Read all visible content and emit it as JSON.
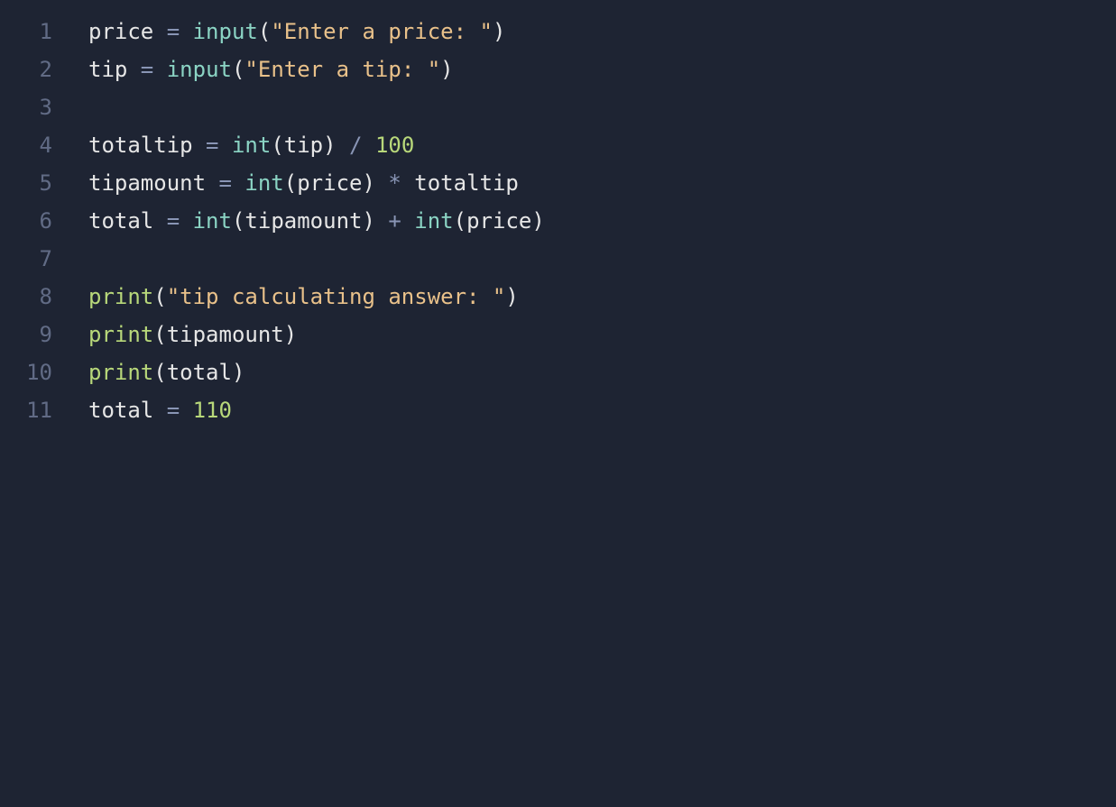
{
  "code": {
    "lines": [
      {
        "num": "1",
        "tokens": [
          {
            "cls": "tok-var",
            "text": "price"
          },
          {
            "cls": "tok-op",
            "text": " = "
          },
          {
            "cls": "tok-func",
            "text": "input"
          },
          {
            "cls": "tok-punct",
            "text": "("
          },
          {
            "cls": "tok-str",
            "text": "\"Enter a price: \""
          },
          {
            "cls": "tok-punct",
            "text": ")"
          }
        ]
      },
      {
        "num": "2",
        "tokens": [
          {
            "cls": "tok-var",
            "text": "tip"
          },
          {
            "cls": "tok-op",
            "text": " = "
          },
          {
            "cls": "tok-func",
            "text": "input"
          },
          {
            "cls": "tok-punct",
            "text": "("
          },
          {
            "cls": "tok-str",
            "text": "\"Enter a tip: \""
          },
          {
            "cls": "tok-punct",
            "text": ")"
          }
        ]
      },
      {
        "num": "3",
        "tokens": []
      },
      {
        "num": "4",
        "tokens": [
          {
            "cls": "tok-var",
            "text": "totaltip"
          },
          {
            "cls": "tok-op",
            "text": " = "
          },
          {
            "cls": "tok-func",
            "text": "int"
          },
          {
            "cls": "tok-punct",
            "text": "("
          },
          {
            "cls": "tok-var",
            "text": "tip"
          },
          {
            "cls": "tok-punct",
            "text": ")"
          },
          {
            "cls": "tok-op",
            "text": " / "
          },
          {
            "cls": "tok-num",
            "text": "100"
          }
        ]
      },
      {
        "num": "5",
        "tokens": [
          {
            "cls": "tok-var",
            "text": "tipamount"
          },
          {
            "cls": "tok-op",
            "text": " = "
          },
          {
            "cls": "tok-func",
            "text": "int"
          },
          {
            "cls": "tok-punct",
            "text": "("
          },
          {
            "cls": "tok-var",
            "text": "price"
          },
          {
            "cls": "tok-punct",
            "text": ")"
          },
          {
            "cls": "tok-op",
            "text": " * "
          },
          {
            "cls": "tok-var",
            "text": "totaltip"
          }
        ]
      },
      {
        "num": "6",
        "tokens": [
          {
            "cls": "tok-var",
            "text": "total"
          },
          {
            "cls": "tok-op",
            "text": " = "
          },
          {
            "cls": "tok-func",
            "text": "int"
          },
          {
            "cls": "tok-punct",
            "text": "("
          },
          {
            "cls": "tok-var",
            "text": "tipamount"
          },
          {
            "cls": "tok-punct",
            "text": ")"
          },
          {
            "cls": "tok-op",
            "text": " + "
          },
          {
            "cls": "tok-func",
            "text": "int"
          },
          {
            "cls": "tok-punct",
            "text": "("
          },
          {
            "cls": "tok-var",
            "text": "price"
          },
          {
            "cls": "tok-punct",
            "text": ")"
          }
        ]
      },
      {
        "num": "7",
        "tokens": []
      },
      {
        "num": "8",
        "tokens": [
          {
            "cls": "tok-call",
            "text": "print"
          },
          {
            "cls": "tok-punct",
            "text": "("
          },
          {
            "cls": "tok-str",
            "text": "\"tip calculating answer: \""
          },
          {
            "cls": "tok-punct",
            "text": ")"
          }
        ]
      },
      {
        "num": "9",
        "tokens": [
          {
            "cls": "tok-call",
            "text": "print"
          },
          {
            "cls": "tok-punct",
            "text": "("
          },
          {
            "cls": "tok-var",
            "text": "tipamount"
          },
          {
            "cls": "tok-punct",
            "text": ")"
          }
        ]
      },
      {
        "num": "10",
        "tokens": [
          {
            "cls": "tok-call",
            "text": "print"
          },
          {
            "cls": "tok-punct",
            "text": "("
          },
          {
            "cls": "tok-var",
            "text": "total"
          },
          {
            "cls": "tok-punct",
            "text": ")"
          }
        ]
      },
      {
        "num": "11",
        "tokens": [
          {
            "cls": "tok-var",
            "text": "total"
          },
          {
            "cls": "tok-op",
            "text": " = "
          },
          {
            "cls": "tok-num",
            "text": "110"
          }
        ]
      }
    ]
  }
}
